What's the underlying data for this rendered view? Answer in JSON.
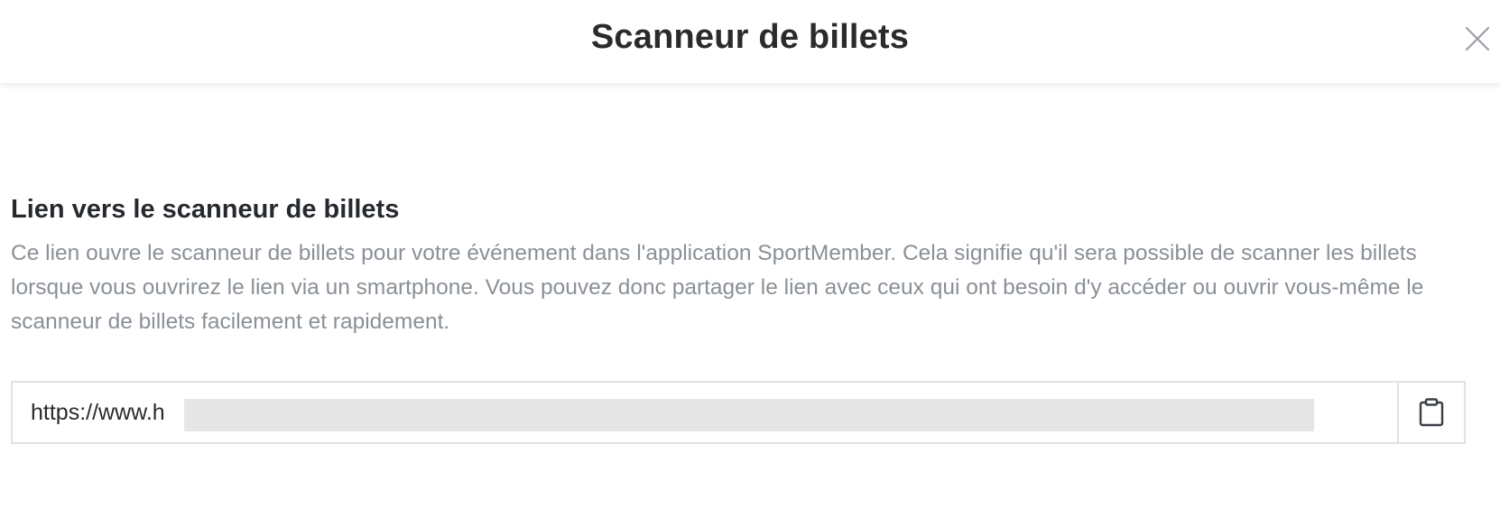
{
  "modal": {
    "title": "Scanneur de billets",
    "close_icon": "close-icon"
  },
  "section": {
    "title": "Lien vers le scanneur de billets",
    "description": "Ce lien ouvre le scanneur de billets pour votre événement dans l'application SportMember. Cela signifie qu'il sera possible de scanner les billets lorsque vous ouvrirez le lien via un smartphone. Vous pouvez donc partager le lien avec ceux qui ont besoin d'y accéder ou ouvrir vous-même le scanneur de billets facilement et rapidement."
  },
  "link": {
    "value": "https://www.h",
    "copy_icon": "clipboard-icon"
  },
  "colors": {
    "title_text": "#2b2b2b",
    "description_text": "#8a9097",
    "border": "#dfe2e7",
    "redaction": "#e6e6e6"
  }
}
